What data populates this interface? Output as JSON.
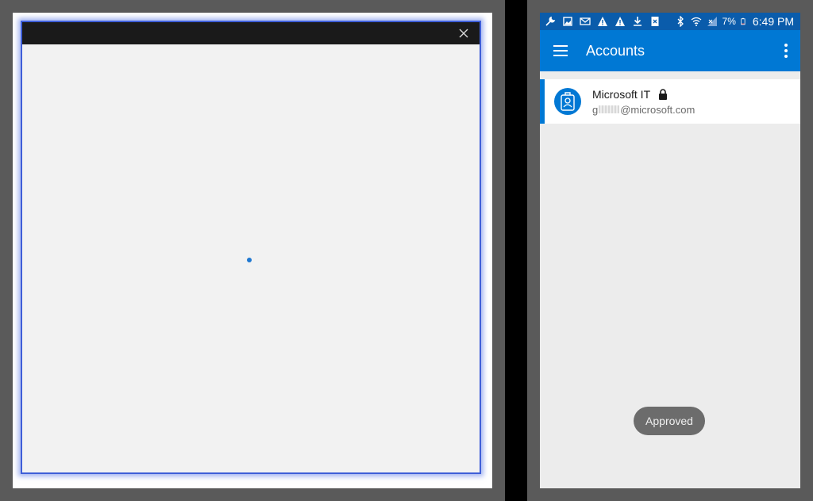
{
  "dialog": {
    "close_icon": "close-icon",
    "content": "loading"
  },
  "phone": {
    "status_bar": {
      "icons_left": [
        "wrench-icon",
        "image-icon",
        "mail-icon",
        "warning-icon",
        "warning-icon",
        "download-icon",
        "file-icon"
      ],
      "icons_right": [
        "bluetooth-icon",
        "wifi-icon",
        "signal-icon"
      ],
      "battery": "7%",
      "time": "6:49 PM"
    },
    "app_bar": {
      "title": "Accounts"
    },
    "accounts": [
      {
        "name": "Microsoft IT",
        "email_prefix": "g",
        "email_domain": "@microsoft.com",
        "locked": true
      }
    ],
    "toast": "Approved"
  },
  "colors": {
    "accent": "#0078d4",
    "status_bar": "#0a5cab",
    "dialog_border": "#3f5fd8"
  }
}
